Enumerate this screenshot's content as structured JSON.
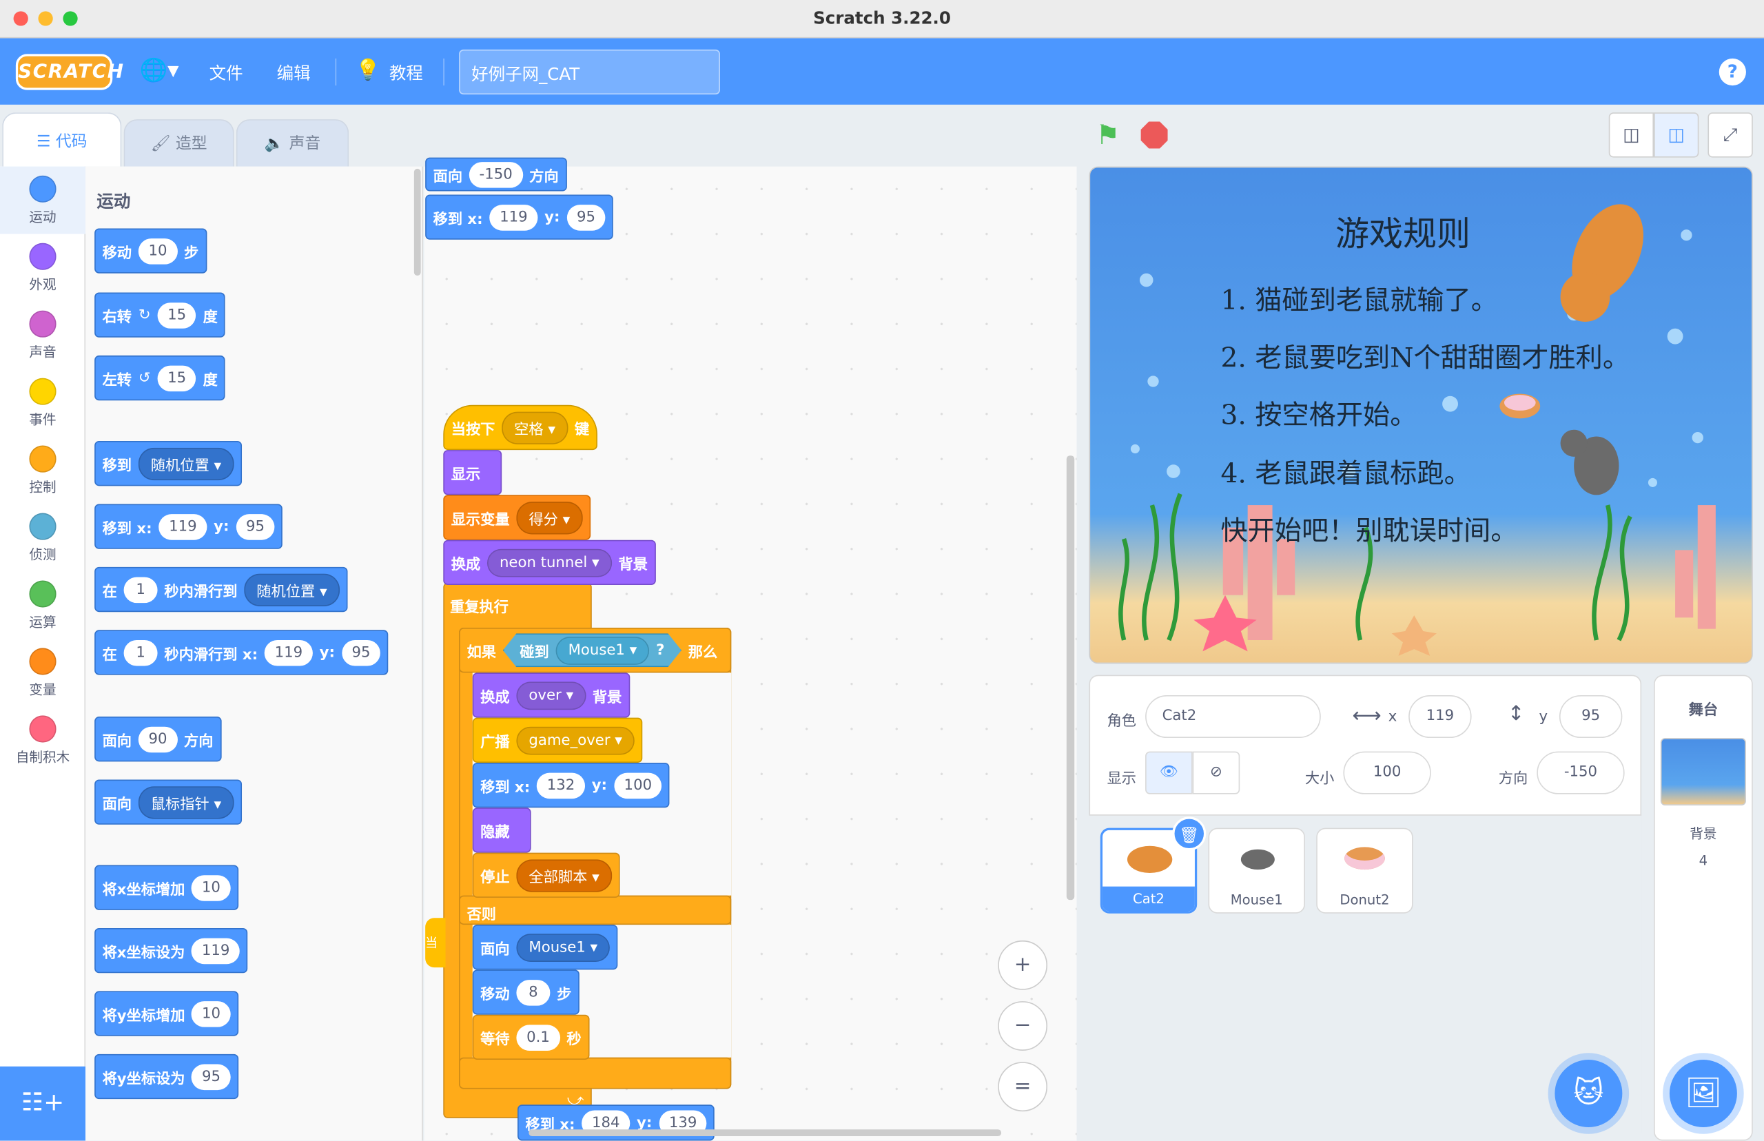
{
  "window": {
    "title": "Scratch 3.22.0"
  },
  "menubar": {
    "logo": "SCRATCH",
    "language_icon": "globe-icon",
    "file": "文件",
    "edit": "编辑",
    "tutorials": "教程",
    "project_title": "好例子网_CAT",
    "help": "?"
  },
  "tabs": [
    {
      "label": "代码",
      "icon": "code-icon"
    },
    {
      "label": "造型",
      "icon": "brush-icon"
    },
    {
      "label": "声音",
      "icon": "speaker-icon"
    }
  ],
  "categories": [
    {
      "label": "运动",
      "color": "#4c97ff"
    },
    {
      "label": "外观",
      "color": "#9966ff"
    },
    {
      "label": "声音",
      "color": "#cf63cf"
    },
    {
      "label": "事件",
      "color": "#ffd500"
    },
    {
      "label": "控制",
      "color": "#ffab19"
    },
    {
      "label": "侦测",
      "color": "#5cb1d6"
    },
    {
      "label": "运算",
      "color": "#59c059"
    },
    {
      "label": "变量",
      "color": "#ff8c1a"
    },
    {
      "label": "自制积木",
      "color": "#ff6680"
    }
  ],
  "palette": {
    "section": "运动",
    "b1": {
      "a": "移动",
      "v": "10",
      "b": "步"
    },
    "b2": {
      "a": "右转",
      "v": "15",
      "b": "度"
    },
    "b3": {
      "a": "左转",
      "v": "15",
      "b": "度"
    },
    "b4": {
      "a": "移到",
      "dd": "随机位置"
    },
    "b5": {
      "a": "移到 x:",
      "x": "119",
      "y_lbl": "y:",
      "y": "95"
    },
    "b6": {
      "a": "在",
      "v": "1",
      "b": "秒内滑行到",
      "dd": "随机位置"
    },
    "b7": {
      "a": "在",
      "v": "1",
      "b": "秒内滑行到 x:",
      "x": "119",
      "y_lbl": "y:",
      "y": "95"
    },
    "b8": {
      "a": "面向",
      "v": "90",
      "b": "方向"
    },
    "b9": {
      "a": "面向",
      "dd": "鼠标指针"
    },
    "b10": {
      "a": "将x坐标增加",
      "v": "10"
    },
    "b11": {
      "a": "将x坐标设为",
      "v": "119"
    },
    "b12": {
      "a": "将y坐标增加",
      "v": "10"
    },
    "b13": {
      "a": "将y坐标设为",
      "v": "95"
    }
  },
  "script": {
    "top1": {
      "a": "面向",
      "v": "-150",
      "b": "方向"
    },
    "top2": {
      "a": "移到 x:",
      "x": "119",
      "y_lbl": "y:",
      "y": "95"
    },
    "hat": {
      "a": "当按下",
      "dd": "空格",
      "b": "键"
    },
    "show": "显示",
    "showvar": {
      "a": "显示变量",
      "dd": "得分"
    },
    "switch1": {
      "a": "换成",
      "dd": "neon tunnel",
      "b": "背景"
    },
    "forever": "重复执行",
    "if": {
      "a": "如果",
      "then": "那么",
      "sensing": "碰到",
      "dd": "Mouse1",
      "q": "?"
    },
    "switch2": {
      "a": "换成",
      "dd": "over",
      "b": "背景"
    },
    "broadcast": {
      "a": "广播",
      "dd": "game_over"
    },
    "goto": {
      "a": "移到 x:",
      "x": "132",
      "y_lbl": "y:",
      "y": "100"
    },
    "hide": "隐藏",
    "stop": {
      "a": "停止",
      "dd": "全部脚本"
    },
    "else": "否则",
    "point": {
      "a": "面向",
      "dd": "Mouse1"
    },
    "move": {
      "a": "移动",
      "v": "8",
      "b": "步"
    },
    "wait": {
      "a": "等待",
      "v": "0.1",
      "b": "秒"
    },
    "bottom": {
      "a": "移到 x:",
      "x": "184",
      "y_lbl": "y:",
      "y": "139"
    },
    "peek": "当"
  },
  "stage": {
    "title": "游戏规则",
    "rules": [
      "1. 猫碰到老鼠就输了。",
      "2. 老鼠要吃到N个甜甜圈才胜利。",
      "3. 按空格开始。",
      "4. 老鼠跟着鼠标跑。",
      "快开始吧！别耽误时间。"
    ]
  },
  "sprite_info": {
    "sprite_label": "角色",
    "sprite_name": "Cat2",
    "x_label": "x",
    "x": "119",
    "y_label": "y",
    "y": "95",
    "show_label": "显示",
    "size_label": "大小",
    "size": "100",
    "direction_label": "方向",
    "direction": "-150"
  },
  "sprites": [
    {
      "name": "Cat2",
      "selected": true
    },
    {
      "name": "Mouse1",
      "selected": false
    },
    {
      "name": "Donut2",
      "selected": false
    }
  ],
  "stage_pane": {
    "title": "舞台",
    "backdrops_label": "背景",
    "backdrops_count": "4"
  },
  "zoom": {
    "in": "+",
    "out": "−",
    "reset": "="
  }
}
